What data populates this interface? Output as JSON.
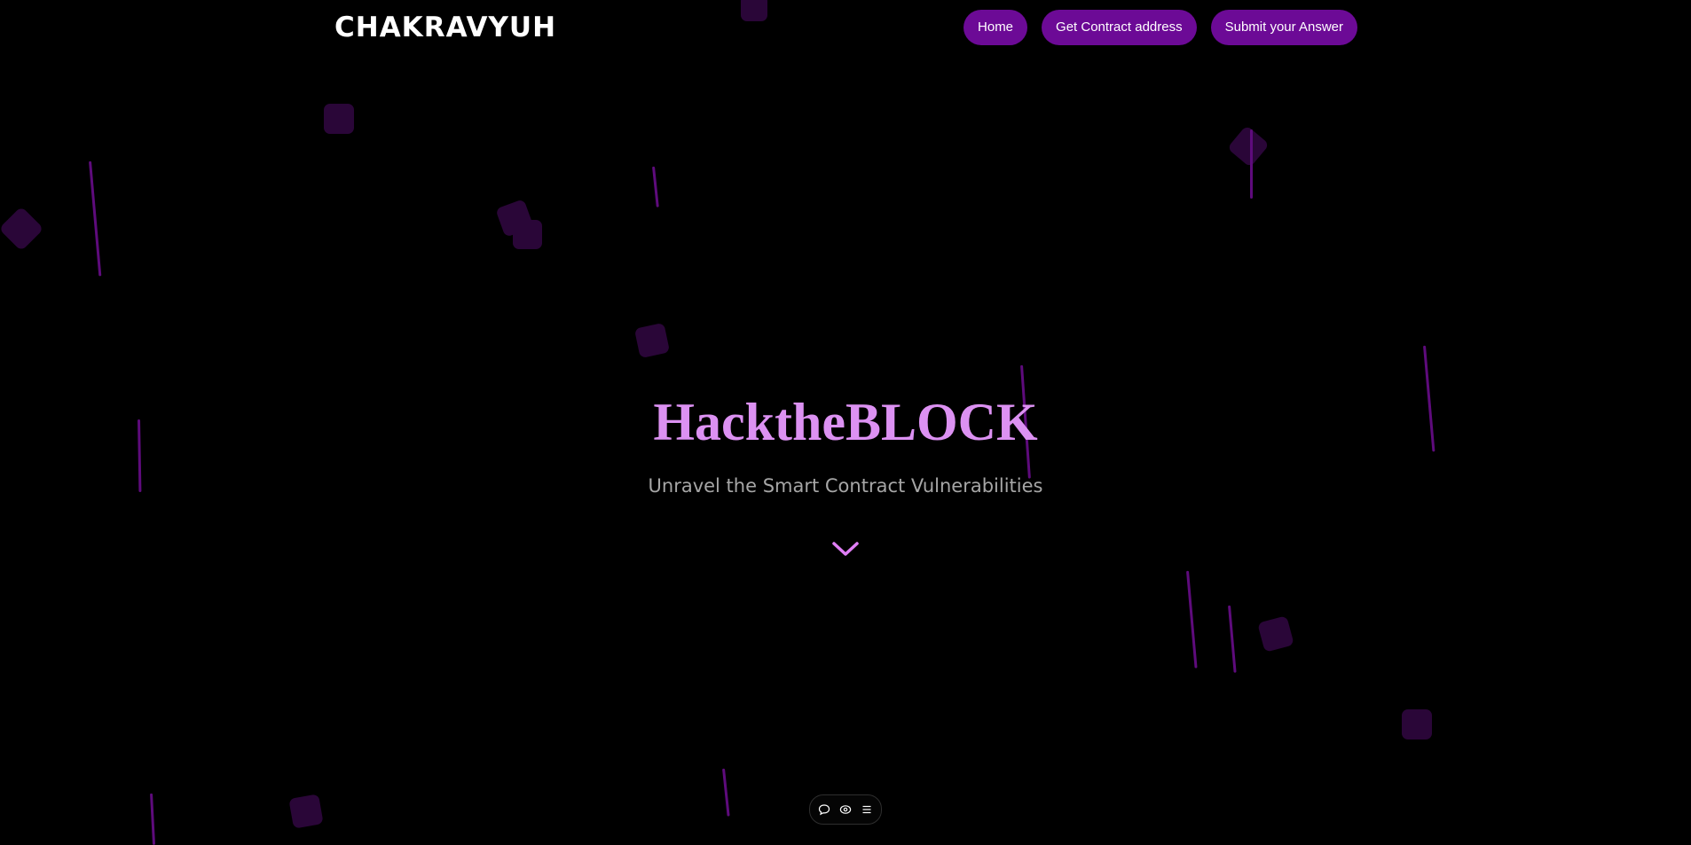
{
  "header": {
    "logo": "CHAKRAVYUH",
    "nav": [
      {
        "label": "Home"
      },
      {
        "label": "Get Contract address"
      },
      {
        "label": "Submit your Answer"
      }
    ]
  },
  "hero": {
    "title": "HacktheBLOCK",
    "subtitle": "Unravel the Smart Contract Vulnerabilities",
    "scroll_icon": "chevron-down-icon"
  },
  "toolbar": {
    "icons": [
      "comment-icon",
      "eye-icon",
      "menu-icon"
    ]
  },
  "colors": {
    "background": "#000000",
    "accent": "#6c0a96",
    "title": "#dc91f2",
    "subtitle": "#a6a6a6",
    "decoration": "#5e0b7c"
  }
}
